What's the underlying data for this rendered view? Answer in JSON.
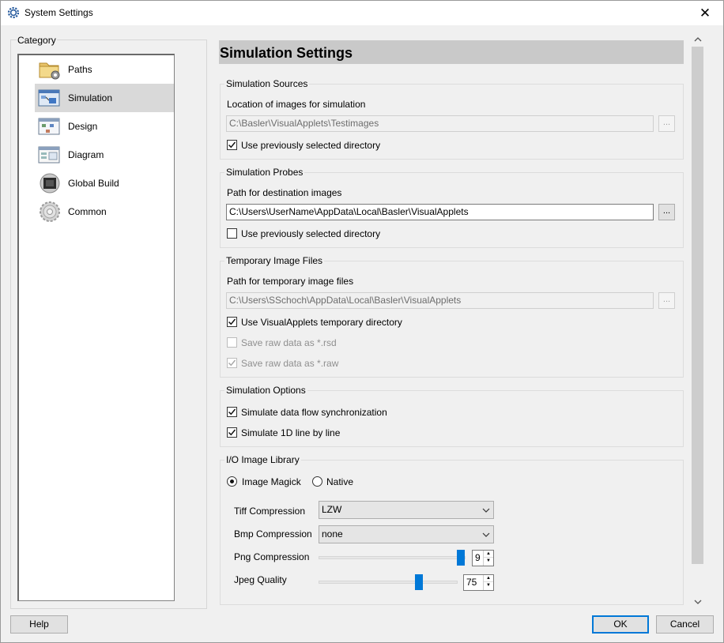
{
  "window": {
    "title": "System Settings",
    "close_glyph": "✕"
  },
  "category": {
    "legend": "Category",
    "items": [
      {
        "label": "Paths",
        "icon": "folder-gear-icon"
      },
      {
        "label": "Simulation",
        "icon": "simulation-icon",
        "selected": true
      },
      {
        "label": "Design",
        "icon": "design-icon"
      },
      {
        "label": "Diagram",
        "icon": "diagram-icon"
      },
      {
        "label": "Global Build",
        "icon": "chip-icon"
      },
      {
        "label": "Common",
        "icon": "gear-icon"
      }
    ]
  },
  "page": {
    "title": "Simulation Settings"
  },
  "sources": {
    "legend": "Simulation Sources",
    "location_label": "Location of images for simulation",
    "path": "C:\\Basler\\VisualApplets\\Testimages",
    "browse": "...",
    "use_prev": {
      "label": "Use previously selected directory",
      "checked": true
    }
  },
  "probes": {
    "legend": "Simulation Probes",
    "path_label": "Path for destination images",
    "path": "C:\\Users\\UserName\\AppData\\Local\\Basler\\VisualApplets",
    "browse": "...",
    "use_prev": {
      "label": "Use previously selected directory",
      "checked": false
    }
  },
  "temp": {
    "legend": "Temporary Image Files",
    "path_label": "Path for temporary image files",
    "path": "C:\\Users\\SSchoch\\AppData\\Local\\Basler\\VisualApplets",
    "browse": "...",
    "use_va": {
      "label": "Use VisualApplets temporary directory",
      "checked": true
    },
    "save_rsd": {
      "label": "Save raw data as *.rsd",
      "checked": false
    },
    "save_raw": {
      "label": "Save raw data as *.raw",
      "checked": true
    }
  },
  "options": {
    "legend": "Simulation Options",
    "sync": {
      "label": "Simulate data flow synchronization",
      "checked": true
    },
    "line": {
      "label": "Simulate 1D line by line",
      "checked": true
    }
  },
  "io": {
    "legend": "I/O Image Library",
    "radio_magick": "Image Magick",
    "radio_native": "Native",
    "tiff_label": "Tiff Compression",
    "tiff_value": "LZW",
    "bmp_label": "Bmp Compression",
    "bmp_value": "none",
    "png_label": "Png Compression",
    "png_value": "9",
    "jpeg_label": "Jpeg Quality",
    "jpeg_value": "75"
  },
  "buttons": {
    "help": "Help",
    "ok": "OK",
    "cancel": "Cancel"
  },
  "colors": {
    "accent": "#0078d7",
    "title_band": "#c9c9c9",
    "selected_item": "#d9d9d9"
  }
}
